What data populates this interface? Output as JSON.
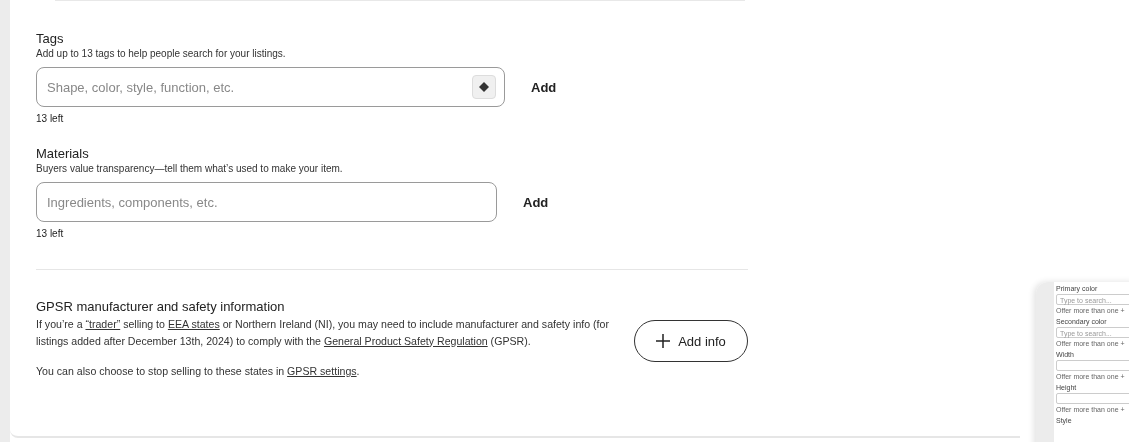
{
  "sections": [
    {
      "title": "Tags",
      "description": "Add up to 13 tags to help people search for your listings.",
      "placeholder": "Shape, color, style, function, etc.",
      "has_suggest_icon": true,
      "action": "Add",
      "counter": "13 left"
    },
    {
      "title": "Materials",
      "description": "Buyers value transparency—tell them what’s used to make your item.",
      "placeholder": "Ingredients, components, etc.",
      "has_suggest_icon": false,
      "action": "Add",
      "counter": "13 left"
    }
  ],
  "gpsr": {
    "title": "GPSR manufacturer and safety information",
    "paragraph": [
      {
        "kind": "text",
        "text": "If you’re a "
      },
      {
        "kind": "link",
        "text": "“trader”"
      },
      {
        "kind": "text",
        "text": " selling to "
      },
      {
        "kind": "link",
        "text": "EEA states"
      },
      {
        "kind": "text",
        "text": " or Northern Ireland (NI), you may need to include manufacturer and safety info (for listings added after December 13th, 2024) to comply with the "
      },
      {
        "kind": "link",
        "text": "General Product Safety Regulation"
      },
      {
        "kind": "text",
        "text": " (GPSR)."
      }
    ],
    "note": [
      {
        "kind": "text",
        "text": "You can also choose to stop selling to these states in "
      },
      {
        "kind": "link",
        "text": "GPSR settings"
      },
      {
        "kind": "text",
        "text": "."
      }
    ],
    "button": "Add info"
  },
  "preview": [
    {
      "kind": "label",
      "text": "Primary color"
    },
    {
      "kind": "field",
      "text": "Type to search..."
    },
    {
      "kind": "hint",
      "text": "Offer more than one +"
    },
    {
      "kind": "label",
      "text": "Secondary color"
    },
    {
      "kind": "field",
      "text": "Type to search..."
    },
    {
      "kind": "hint",
      "text": "Offer more than one +"
    },
    {
      "kind": "label",
      "text": "Width"
    },
    {
      "kind": "field"
    },
    {
      "kind": "hint",
      "text": "Offer more than one +"
    },
    {
      "kind": "label",
      "text": "Height"
    },
    {
      "kind": "field"
    },
    {
      "kind": "hint",
      "text": "Offer more than one +"
    },
    {
      "kind": "label",
      "text": "Style"
    }
  ]
}
